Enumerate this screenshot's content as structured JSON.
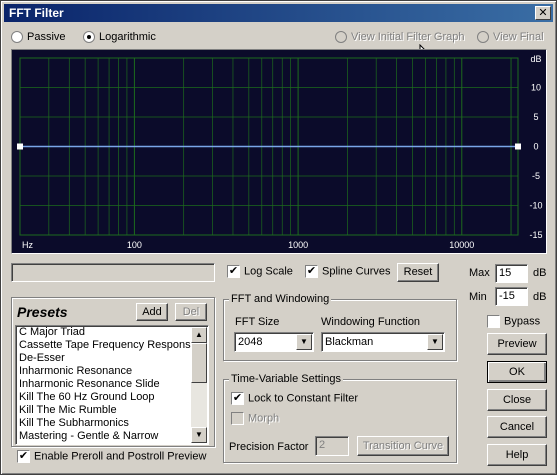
{
  "window": {
    "title": "FFT Filter",
    "close_glyph": "✕"
  },
  "mode": {
    "passive_label": "Passive",
    "logarithmic_label": "Logarithmic",
    "selected": "logarithmic"
  },
  "view": {
    "initial_label": "View Initial Filter Graph",
    "final_label": "View Final"
  },
  "graph": {
    "db_unit": "dB",
    "db_ticks": [
      "10",
      "5",
      "0",
      "-5",
      "-10",
      "-15"
    ],
    "hz_unit": "Hz",
    "freq_ticks": [
      "100",
      "1000",
      "10000"
    ],
    "line_color": "#7aa6e8",
    "grid_color": "#1d6b1d",
    "background": "#0b0b2a"
  },
  "options": {
    "log_scale_label": "Log Scale",
    "log_scale_checked": true,
    "spline_label": "Spline Curves",
    "spline_checked": true,
    "reset_label": "Reset"
  },
  "range": {
    "max_label": "Max",
    "max_value": "15",
    "min_label": "Min",
    "min_value": "-15",
    "unit": "dB"
  },
  "presets": {
    "title": "Presets",
    "add_label": "Add",
    "del_label": "Del",
    "items": [
      "C Major Triad",
      "Cassette Tape Frequency Response",
      "De-Esser",
      "Inharmonic Resonance",
      "Inharmonic Resonance Slide",
      "Kill The 60 Hz  Ground Loop",
      "Kill The Mic Rumble",
      "Kill The Subharmonics",
      "Mastering - Gentle & Narrow"
    ],
    "preview_option_label": "Enable Preroll and Postroll Preview",
    "preview_option_checked": true
  },
  "fft": {
    "group_label": "FFT and Windowing",
    "size_label": "FFT Size",
    "size_value": "2048",
    "window_label": "Windowing Function",
    "window_value": "Blackman"
  },
  "time_variable": {
    "group_label": "Time-Variable Settings",
    "lock_label": "Lock to Constant Filter",
    "lock_checked": true,
    "morph_label": "Morph",
    "precision_label": "Precision Factor",
    "precision_value": "2",
    "transition_label": "Transition Curve"
  },
  "side_buttons": {
    "bypass_label": "Bypass",
    "preview_label": "Preview",
    "ok_label": "OK",
    "close_label": "Close",
    "cancel_label": "Cancel",
    "help_label": "Help"
  }
}
